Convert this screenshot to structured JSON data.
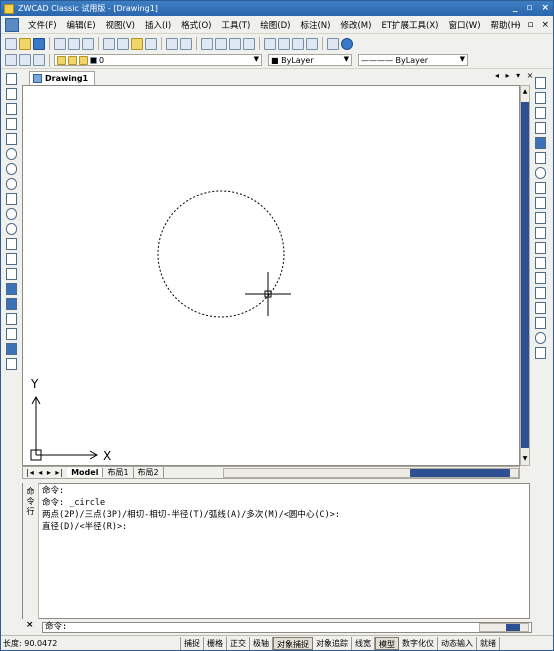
{
  "window": {
    "title": "ZWCAD Classic 试用版 - [Drawing1]",
    "minimize": "_",
    "restore": "▫",
    "close": "×"
  },
  "menu": [
    "文件(F)",
    "编辑(E)",
    "视图(V)",
    "插入(I)",
    "格式(O)",
    "工具(T)",
    "绘图(D)",
    "标注(N)",
    "修改(M)",
    "ET扩展工具(X)",
    "窗口(W)",
    "帮助(H)"
  ],
  "doc_controls": {
    "minimize": "-",
    "restore": "▫",
    "close": "×"
  },
  "layer_combo": {
    "value": "0"
  },
  "color_combo": {
    "value": "■ ByLayer"
  },
  "linetype_combo": {
    "value": "———— ByLayer"
  },
  "doc_tab": {
    "label": "Drawing1",
    "nav": "◂ ▸ ▾ ×"
  },
  "layout_tabs": {
    "nav": "|◂ ◂ ▸ ▸|",
    "tabs": [
      "Model",
      "布局1",
      "布局2"
    ]
  },
  "ucs": {
    "x_label": "X",
    "y_label": "Y"
  },
  "command": {
    "grip_label": "命令行",
    "lines": [
      "命令:",
      "命令: _circle",
      "两点(2P)/三点(3P)/相切-相切-半径(T)/弧线(A)/多次(M)/<圆中心(C)>:",
      "直径(D)/<半径(R)>:"
    ],
    "prompt": "命令:",
    "close": "×"
  },
  "status": {
    "coord": "长度: 90.0472",
    "buttons": [
      {
        "label": "捕捉",
        "on": false
      },
      {
        "label": "栅格",
        "on": false
      },
      {
        "label": "正交",
        "on": false
      },
      {
        "label": "极轴",
        "on": false
      },
      {
        "label": "对象捕捉",
        "on": true
      },
      {
        "label": "对象追踪",
        "on": false
      },
      {
        "label": "线宽",
        "on": false
      },
      {
        "label": "模型",
        "on": true
      },
      {
        "label": "数字化仪",
        "on": false
      },
      {
        "label": "动态输入",
        "on": false
      },
      {
        "label": "就绪",
        "on": false
      }
    ]
  }
}
